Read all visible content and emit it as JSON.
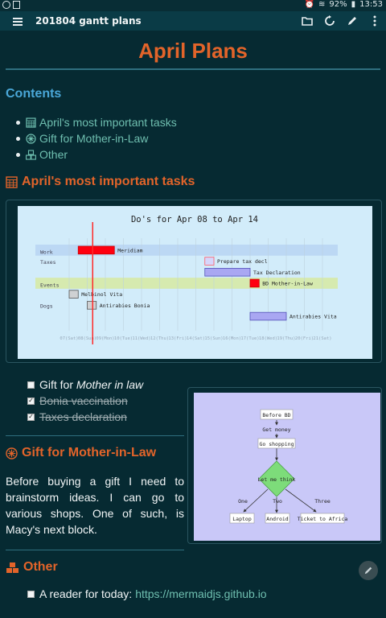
{
  "status": {
    "battery": "92%",
    "time": "13:53"
  },
  "toolbar": {
    "title": "201804 gantt plans"
  },
  "page": {
    "title": "April Plans"
  },
  "contents": {
    "heading": "Contents",
    "items": [
      {
        "label": "April's most important tasks",
        "icon": "calendar-icon"
      },
      {
        "label": "Gift for Mother-in-Law",
        "icon": "gear-flower-icon"
      },
      {
        "label": "Other",
        "icon": "cubes-icon"
      }
    ]
  },
  "section1": {
    "heading": "April's most important tasks"
  },
  "gantt": {
    "title": "Do's for Apr 08 to Apr 14",
    "sections": [
      "Work",
      "Taxes",
      "Events",
      "Dogs"
    ],
    "tasks": [
      {
        "label": "Meridiam",
        "start": 0.5,
        "end": 2.5,
        "row": 0,
        "style": "critical"
      },
      {
        "label": "Prepare tax decl",
        "start": 7.5,
        "end": 8.0,
        "row": 1,
        "style": "active"
      },
      {
        "label": "Tax Declaration",
        "start": 7.5,
        "end": 10.0,
        "row": 2,
        "style": "normal"
      },
      {
        "label": "BD Mother-in-Law",
        "start": 10.0,
        "end": 10.5,
        "row": 3,
        "style": "critical"
      },
      {
        "label": "Melbinol Vita",
        "start": 0.0,
        "end": 0.5,
        "row": 4,
        "style": "done"
      },
      {
        "label": "Antirabies Bonia",
        "start": 1.0,
        "end": 1.5,
        "row": 5,
        "style": "done"
      },
      {
        "label": "Antirabies Vita",
        "start": 10.0,
        "end": 12.0,
        "row": 6,
        "style": "normal"
      }
    ],
    "ticks": [
      "07(Sat)",
      "08(Sun)",
      "09(Mon)",
      "10(Tue)",
      "11(Wed)",
      "12(Thu)",
      "13(Fri)",
      "14(Sat)",
      "15(Sun)",
      "16(Mon)",
      "17(Tue)",
      "18(Wed)",
      "19(Thu)",
      "20(Fri)",
      "21(Sat)"
    ],
    "today": 1.3
  },
  "tasks": [
    {
      "label_plain": "Gift for ",
      "label_em": "Mother in law",
      "checked": false,
      "done": false
    },
    {
      "label_plain": "Bonia vaccination",
      "label_em": "",
      "checked": true,
      "done": true
    },
    {
      "label_plain": "Taxes declaration",
      "label_em": "",
      "checked": true,
      "done": true
    }
  ],
  "flow": {
    "nodes": [
      "Before BD",
      "Get money",
      "Go shopping",
      "Let me think",
      "Laptop",
      "Android",
      "Ticket to Africa"
    ],
    "edges": [
      "One",
      "Two",
      "Three"
    ]
  },
  "section2": {
    "heading": "Gift for Mother-in-Law",
    "text": "Before buying a gift I need to brainstorm ideas. I can go to various shops. One of such, is Macy's next block."
  },
  "section3": {
    "heading": "Other"
  },
  "reader": {
    "label": "A reader for today:",
    "link": "https://mermaidjs.github.io"
  },
  "colors": {
    "accent": "#e2642a",
    "link": "#6fbfb0",
    "heading_blue": "#4aa7d8",
    "bg": "#062a32"
  }
}
